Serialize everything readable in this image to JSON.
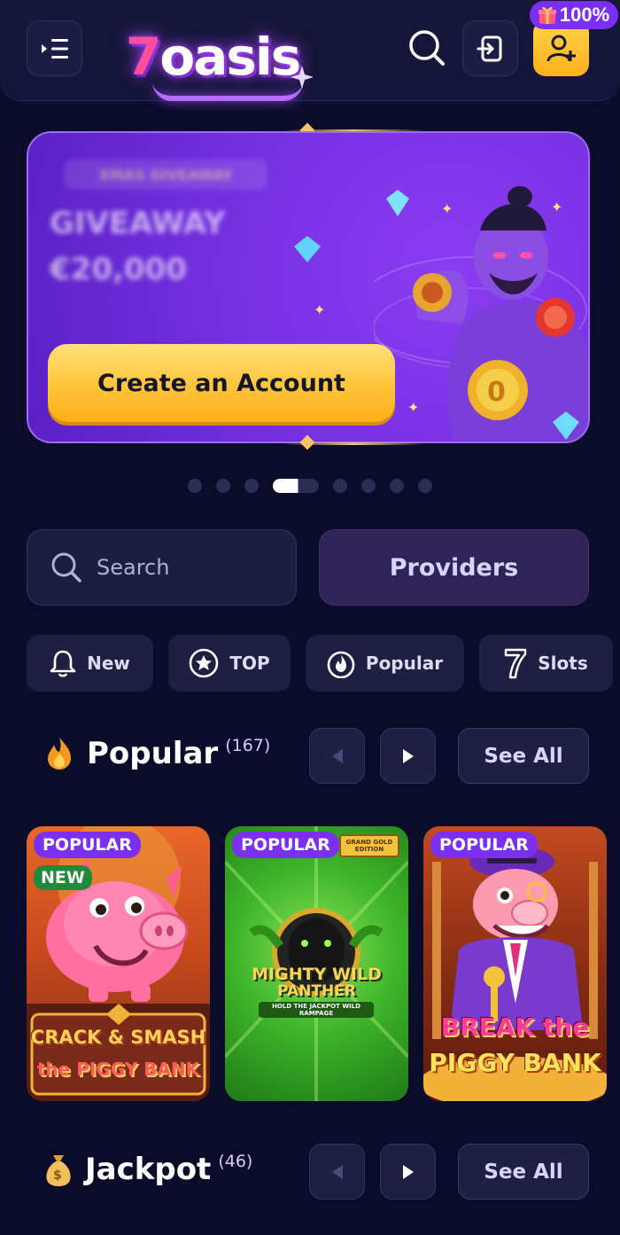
{
  "header": {
    "logo_text_seven": "7",
    "logo_text_rest": "oasis",
    "bonus_badge": "100%"
  },
  "banner": {
    "eyebrow": "XMAS GIVEAWAY",
    "line1": "GIVEAWAY",
    "line2": "€20,000",
    "cta_label": "Create an Account"
  },
  "carousel": {
    "dot_count": 8,
    "active_index": 3
  },
  "search": {
    "placeholder": "Search"
  },
  "providers_label": "Providers",
  "chips": [
    {
      "label": "New",
      "icon": "bell-icon"
    },
    {
      "label": "TOP",
      "icon": "star-icon"
    },
    {
      "label": "Popular",
      "icon": "flame-icon"
    },
    {
      "label": "Slots",
      "icon": "seven-icon"
    }
  ],
  "sections": {
    "popular": {
      "title": "Popular",
      "count": "(167)",
      "see_all": "See All",
      "games": [
        {
          "badge": "POPULAR",
          "extra_badge": "NEW",
          "line1": "CRACK & SMASH",
          "line2": "the PIGGY BANK"
        },
        {
          "badge": "POPULAR",
          "tag": "GRAND GOLD EDITION",
          "line1": "MIGHTY WILD",
          "line2": "PANTHER",
          "line3": "HOLD THE JACKPOT WILD RAMPAGE"
        },
        {
          "badge": "POPULAR",
          "line1": "BREAK the",
          "line2": "PIGGY BANK"
        }
      ]
    },
    "jackpot": {
      "title": "Jackpot",
      "count": "(46)",
      "see_all": "See All"
    }
  },
  "colors": {
    "background": "#0b0c2a",
    "accent_purple": "#7b2ff0",
    "accent_yellow": "#ffc43a"
  }
}
